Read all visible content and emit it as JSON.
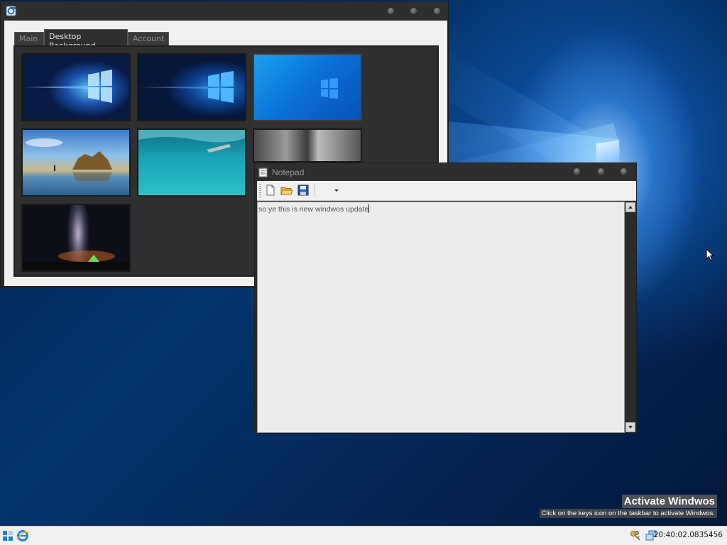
{
  "desktop": {
    "activation": {
      "title": "Activate Windwos",
      "subtitle": "Click on the keys icon on the taskbar to activate Windwos."
    }
  },
  "settings_window": {
    "icon": "app-icon",
    "tabs": [
      {
        "label": "Main",
        "active": false
      },
      {
        "label": "Desktop Background",
        "active": true
      },
      {
        "label": "Account",
        "active": false
      }
    ],
    "wallpapers": [
      {
        "name": "windows-hero-light-wallpaper"
      },
      {
        "name": "windows-hero-dark-wallpaper"
      },
      {
        "name": "windows-blue-wallpaper"
      },
      {
        "name": "beach-rocks-wallpaper"
      },
      {
        "name": "underwater-swimmer-wallpaper"
      },
      {
        "name": "rock-cliff-wallpaper"
      },
      {
        "name": "milky-way-tent-wallpaper"
      }
    ]
  },
  "notepad": {
    "title": "Notepad",
    "toolbar": {
      "new_icon": "new-file-icon",
      "open_icon": "open-folder-icon",
      "save_icon": "save-disk-icon",
      "dropdown_icon": "dropdown-arrow-icon"
    },
    "content": "so ye this is new windwos update"
  },
  "taskbar": {
    "start_icon": "start-icon",
    "browser_icon": "internet-explorer-icon",
    "tray_keys_icon": "keys-icon",
    "tray_network_icon": "network-icon",
    "clock": "20:40:02.0835456"
  }
}
